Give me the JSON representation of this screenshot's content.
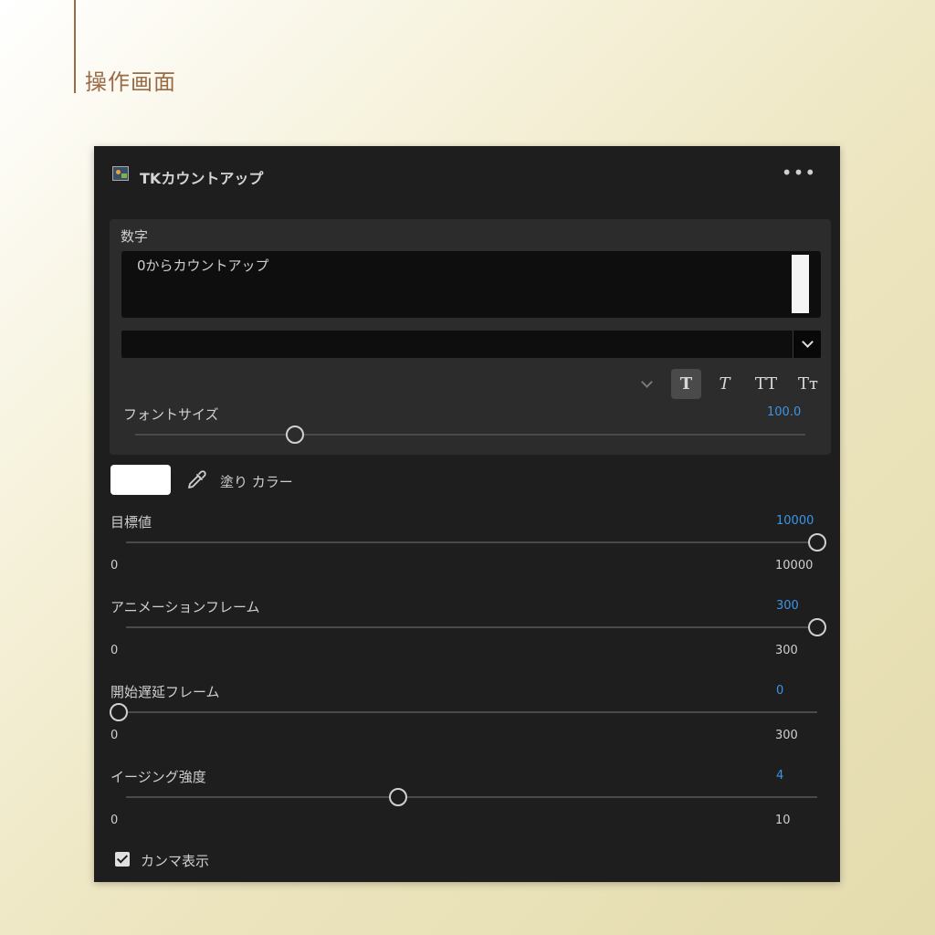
{
  "page": {
    "title": "操作画面"
  },
  "panel": {
    "title": "TKカウントアップ",
    "menu_icon": "more-horizontal-icon",
    "plugin_icon": "plugin-icon"
  },
  "text_section": {
    "label": "数字",
    "text_value": "0からカウントアップ",
    "font_value": "",
    "style_buttons": [
      "T",
      "T",
      "TT",
      "Tт"
    ],
    "active_style": "bold",
    "font_size": {
      "label": "フォントサイズ",
      "value": "100.0"
    }
  },
  "fill": {
    "label": "塗り カラー",
    "color": "#ffffff",
    "icon": "eyedropper-icon"
  },
  "params": [
    {
      "label": "目標値",
      "value": "10000",
      "min": "0",
      "max": "10000",
      "fraction": 1.0
    },
    {
      "label": "アニメーションフレーム",
      "value": "300",
      "min": "0",
      "max": "300",
      "fraction": 1.0
    },
    {
      "label": "開始遅延フレーム",
      "value": "0",
      "min": "0",
      "max": "300",
      "fraction": 0.0
    },
    {
      "label": "イージング強度",
      "value": "4",
      "min": "0",
      "max": "10",
      "fraction": 0.4
    }
  ],
  "comma": {
    "label": "カンマ表示",
    "checked": true
  },
  "colors": {
    "accent": "#3d95e6",
    "panel_bg": "#1e1e1e",
    "section_bg": "#2c2c2c",
    "heading": "#9a6a45"
  }
}
